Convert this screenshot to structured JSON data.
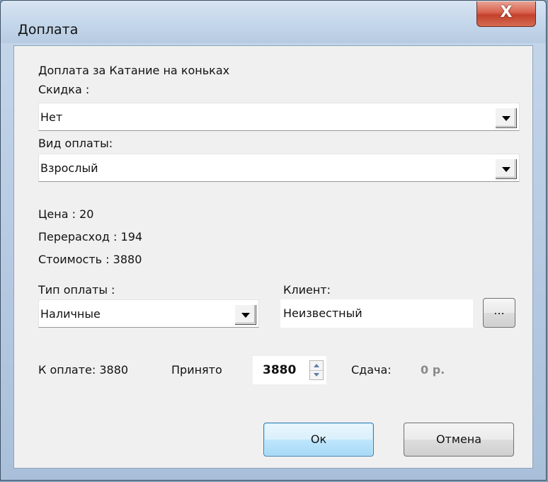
{
  "window": {
    "title": "Доплата",
    "close_label": "X"
  },
  "header_text": "Доплата за Катание на коньках",
  "discount": {
    "label": "Скидка :",
    "value": "Нет"
  },
  "payment_kind": {
    "label": "Вид оплаты:",
    "value": "Взрослый"
  },
  "info": {
    "price": "Цена : 20",
    "overuse": "Перерасход : 194",
    "cost": "Стоимость : 3880"
  },
  "payment_type": {
    "label": "Тип оплаты :",
    "value": "Наличные"
  },
  "client": {
    "label": "Клиент:",
    "value": "Неизвестный",
    "browse_label": "..."
  },
  "totals": {
    "to_pay": "К оплате: 3880",
    "accepted_label": "Принято",
    "accepted_value": "3880",
    "change_label": "Сдача:",
    "change_value": "0 р."
  },
  "buttons": {
    "ok": "Ок",
    "cancel": "Отмена"
  }
}
